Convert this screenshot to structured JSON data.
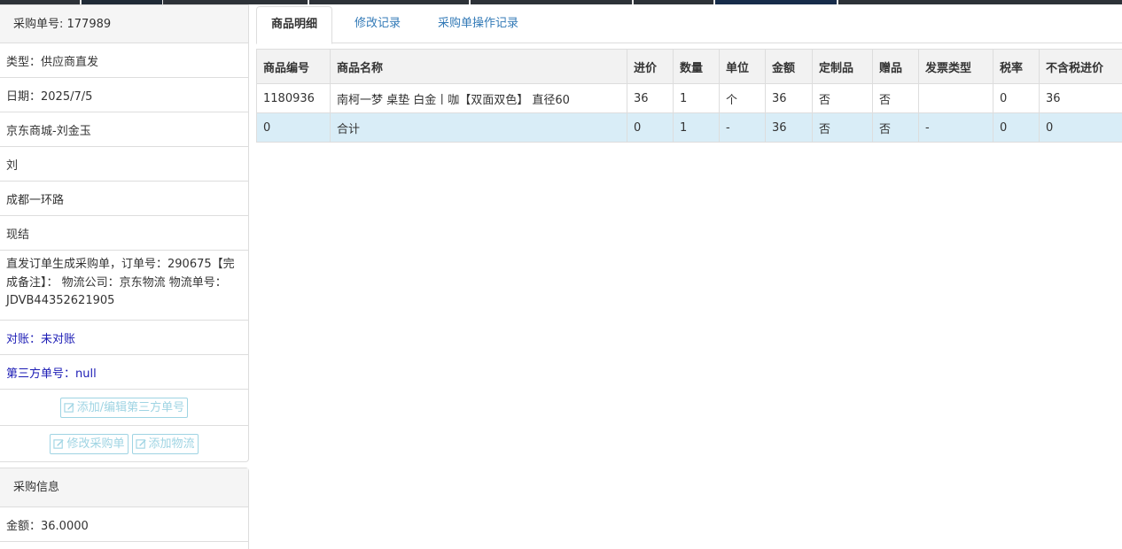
{
  "colors": {
    "topbar": [
      "#2d3238",
      "#1f2a36",
      "#2d3238",
      "#2d3238",
      "#2d3238",
      "#2d3238",
      "#2d3238",
      "#172c4a",
      "#2d3238"
    ],
    "link": "#337ab7",
    "blue_text": "#1b1bb5",
    "total_row_bg": "#d9edf7",
    "button_outline": "#9fd4e3"
  },
  "order_panel": {
    "header": "采购单号: 177989",
    "type": "类型：供应商直发",
    "date": "日期：2025/7/5",
    "shop": "京东商城-刘金玉",
    "name": "刘",
    "address": "成都一环路",
    "settlement": "现结",
    "note": "直发订单生成采购单，订单号：290675【完成备注】：  物流公司：京东物流 物流单号：JDVB44352621905",
    "reconcile": "对账：未对账",
    "third_party": "第三方单号：null",
    "buttons": {
      "add_edit_third": "添加/编辑第三方单号",
      "modify_order": "修改采购单",
      "add_logistics": "添加物流"
    }
  },
  "purchase_info": {
    "header": "采购信息",
    "amount": "金额：36.0000"
  },
  "tabs": [
    {
      "label": "商品明细",
      "active": true
    },
    {
      "label": "修改记录",
      "active": false
    },
    {
      "label": "采购单操作记录",
      "active": false
    }
  ],
  "table": {
    "columns": [
      "商品编号",
      "商品名称",
      "进价",
      "数量",
      "单位",
      "金额",
      "定制品",
      "赠品",
      "发票类型",
      "税率",
      "不含税进价"
    ],
    "rows": [
      [
        "1180936",
        "南柯一梦 桌垫 白金丨咖【双面双色】 直径60",
        "36",
        "1",
        "个",
        "36",
        "否",
        "否",
        "",
        "0",
        "36"
      ]
    ],
    "total": [
      "0",
      "合计",
      "0",
      "1",
      "-",
      "36",
      "否",
      "否",
      "-",
      "0",
      "0"
    ]
  }
}
